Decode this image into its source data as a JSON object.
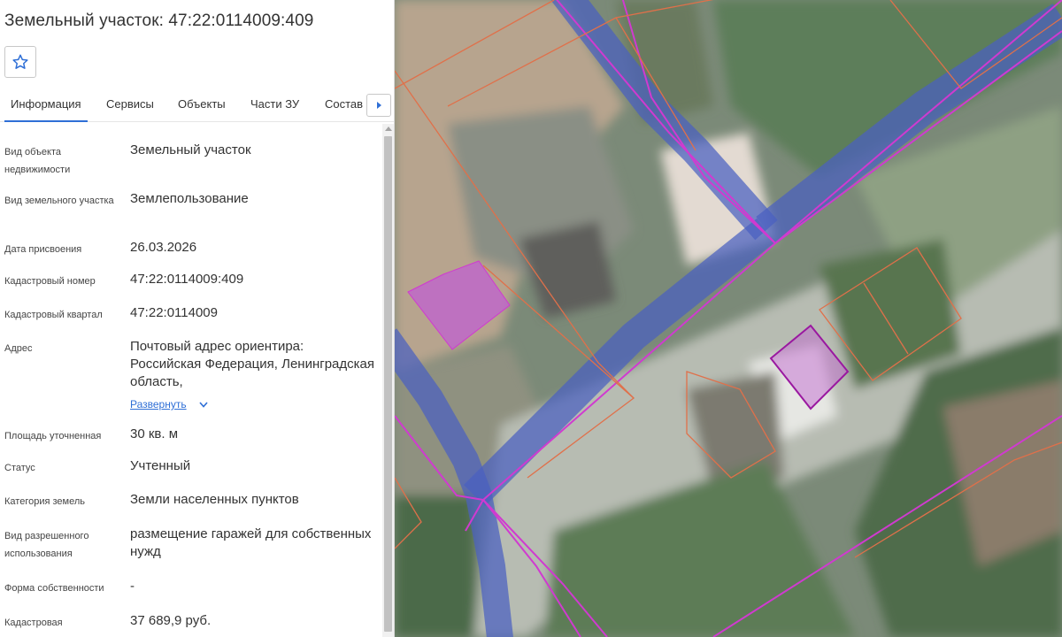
{
  "panel": {
    "title": "Земельный участок: 47:22:0114009:409",
    "favorite_icon": "star-outline-icon",
    "tabs": [
      {
        "label": "Информация",
        "active": true
      },
      {
        "label": "Сервисы",
        "active": false
      },
      {
        "label": "Объекты",
        "active": false
      },
      {
        "label": "Части ЗУ",
        "active": false
      },
      {
        "label": "Состав",
        "active": false
      }
    ],
    "tabs_more_icon": "caret-right-icon",
    "accent_color": "#2f6fd6",
    "rows": [
      {
        "label": "Вид объекта недвижимости",
        "value": "Земельный участок"
      },
      {
        "label": "Вид земельного участка",
        "value": "Землепользование"
      },
      {
        "label": "Дата присвоения",
        "value": "26.03.2026"
      },
      {
        "label": "Кадастровый номер",
        "value": "47:22:0114009:409"
      },
      {
        "label": "Кадастровый квартал",
        "value": "47:22:0114009"
      },
      {
        "label": "Адрес",
        "value": "Почтовый адрес ориентира: Российская Федерация, Ленинградская область,",
        "expand": "Развернуть"
      },
      {
        "label": "Площадь уточненная",
        "value": "30 кв. м"
      },
      {
        "label": "Статус",
        "value": "Учтенный"
      },
      {
        "label": "Категория земель",
        "value": "Земли населенных пунктов"
      },
      {
        "label": "Вид разрешенного использования",
        "value": "размещение гаражей для собственных нужд"
      },
      {
        "label": "Форма собственности",
        "value": "-"
      },
      {
        "label": "Кадастровая",
        "value": "37 689,9 руб."
      }
    ]
  },
  "map": {
    "road_color": "#4a5fc1",
    "parcel_outline_color": "#e0704a",
    "boundary_color": "#d03ad0",
    "selected_fill_color": "#c060d0"
  }
}
